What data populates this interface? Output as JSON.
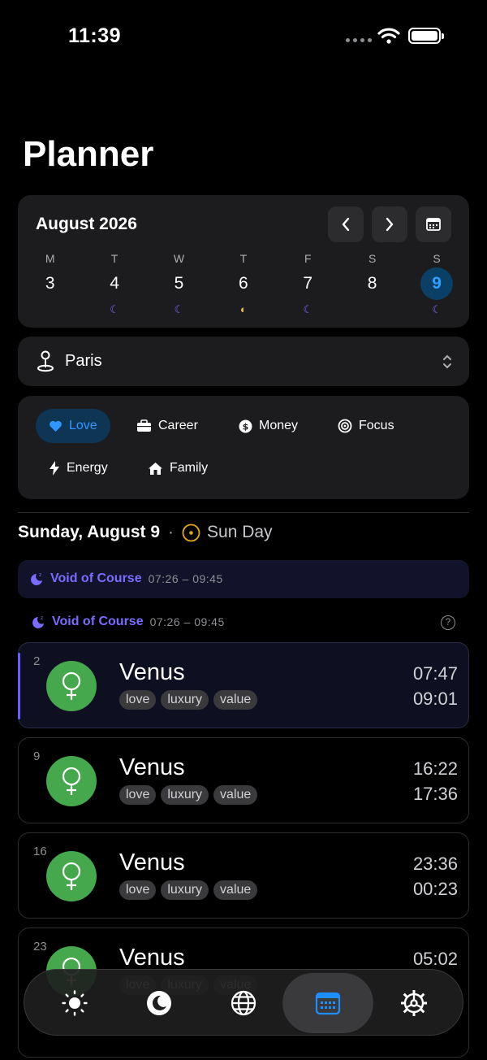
{
  "status": {
    "time": "11:39"
  },
  "title": "Planner",
  "calendar": {
    "month": "August 2026",
    "days": [
      {
        "name": "M",
        "num": "3",
        "moon": ""
      },
      {
        "name": "T",
        "num": "4",
        "moon": "☾"
      },
      {
        "name": "W",
        "num": "5",
        "moon": "☾"
      },
      {
        "name": "T",
        "num": "6",
        "moon": "◐"
      },
      {
        "name": "F",
        "num": "7",
        "moon": "☾"
      },
      {
        "name": "S",
        "num": "8",
        "moon": ""
      },
      {
        "name": "S",
        "num": "9",
        "moon": "☾",
        "selected": true
      }
    ]
  },
  "location": {
    "name": "Paris"
  },
  "categories": [
    {
      "label": "Love",
      "icon": "heart-icon",
      "active": true
    },
    {
      "label": "Career",
      "icon": "briefcase-icon"
    },
    {
      "label": "Money",
      "icon": "dollar-icon"
    },
    {
      "label": "Focus",
      "icon": "target-icon"
    },
    {
      "label": "Energy",
      "icon": "bolt-icon"
    },
    {
      "label": "Family",
      "icon": "house-icon"
    }
  ],
  "day": {
    "date": "Sunday, August 9",
    "separator": "·",
    "type": "Sun Day"
  },
  "void_banner": {
    "label": "Void of Course",
    "time": "07:26 – 09:45"
  },
  "void_row": {
    "label": "Void of Course",
    "time": "07:26 – 09:45",
    "help": "?"
  },
  "transits": [
    {
      "num": "2",
      "planet": "Venus",
      "tags": [
        "love",
        "luxury",
        "value"
      ],
      "start": "07:47",
      "end": "09:01"
    },
    {
      "num": "9",
      "planet": "Venus",
      "tags": [
        "love",
        "luxury",
        "value"
      ],
      "start": "16:22",
      "end": "17:36"
    },
    {
      "num": "16",
      "planet": "Venus",
      "tags": [
        "love",
        "luxury",
        "value"
      ],
      "start": "23:36",
      "end": "00:23"
    },
    {
      "num": "23",
      "planet": "Venus",
      "tags": [
        "love",
        "luxury",
        "value"
      ],
      "start": "05:02",
      "end": ""
    }
  ],
  "colors": {
    "accent": "#2ea0ff",
    "void": "#7a6cff",
    "venus": "#45a84c"
  },
  "tabs": [
    "sun-icon",
    "moon-icon",
    "globe-icon",
    "calendar-icon",
    "gear-icon"
  ]
}
